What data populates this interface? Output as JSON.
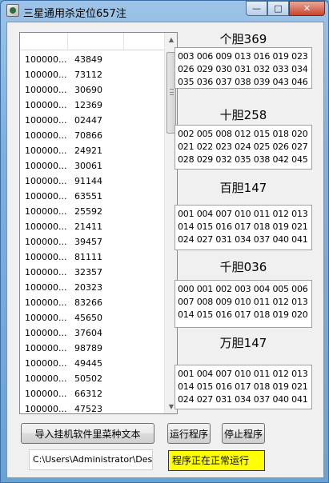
{
  "window": {
    "title": "三星通用杀定位657注",
    "minimize_label": "—",
    "maximize_label": "□",
    "close_label": "✕"
  },
  "list": {
    "rows": [
      {
        "a": "100000...",
        "b": "43849"
      },
      {
        "a": "100000...",
        "b": "73112"
      },
      {
        "a": "100000...",
        "b": "30690"
      },
      {
        "a": "100000...",
        "b": "12369"
      },
      {
        "a": "100000...",
        "b": "02447"
      },
      {
        "a": "100000...",
        "b": "70866"
      },
      {
        "a": "100000...",
        "b": "24921"
      },
      {
        "a": "100000...",
        "b": "30061"
      },
      {
        "a": "100000...",
        "b": "91144"
      },
      {
        "a": "100000...",
        "b": "63551"
      },
      {
        "a": "100000...",
        "b": "25592"
      },
      {
        "a": "100000...",
        "b": "21411"
      },
      {
        "a": "100000...",
        "b": "39457"
      },
      {
        "a": "100000...",
        "b": "81111"
      },
      {
        "a": "100000...",
        "b": "32357"
      },
      {
        "a": "100000...",
        "b": "20323"
      },
      {
        "a": "100000...",
        "b": "83266"
      },
      {
        "a": "100000...",
        "b": "45650"
      },
      {
        "a": "100000...",
        "b": "37604"
      },
      {
        "a": "100000...",
        "b": "98789"
      },
      {
        "a": "100000...",
        "b": "49445"
      },
      {
        "a": "100000...",
        "b": "50502"
      },
      {
        "a": "100000...",
        "b": "66312"
      },
      {
        "a": "100000...",
        "b": "47523"
      }
    ]
  },
  "panels": [
    {
      "title": "个胆369",
      "lines": [
        "003 006 009 013 016 019 023",
        "026 029 030 031 032 033 034",
        "035 036 037 038 039 043 046"
      ]
    },
    {
      "title": "十胆258",
      "lines": [
        "002 005 008 012 015 018 020",
        "021 022 023 024 025 026 027",
        "028 029 032 035 038 042 045"
      ]
    },
    {
      "title": "百胆147",
      "lines": [
        "001 004 007 010 011 012 013",
        "014 015 016 017 018 019 021",
        "024 027 031 034 037 040 041"
      ]
    },
    {
      "title": "千胆036",
      "lines": [
        "000 001 002 003 004 005 006",
        "007 008 009 010 011 012 013",
        "014 015 016 017 018 019 020"
      ]
    },
    {
      "title": "万胆147",
      "lines": [
        "001 004 007 010 011 012 013",
        "014 015 016 017 018 019 021",
        "024 027 031 034 037 040 041"
      ]
    }
  ],
  "buttons": {
    "import": "导入挂机软件里菜种文本",
    "run": "运行程序",
    "stop": "停止程序"
  },
  "path_field": {
    "value": "C:\\Users\\Administrator\\Des"
  },
  "status": {
    "text": "程序正在正常运行",
    "color": "#ffff00"
  }
}
